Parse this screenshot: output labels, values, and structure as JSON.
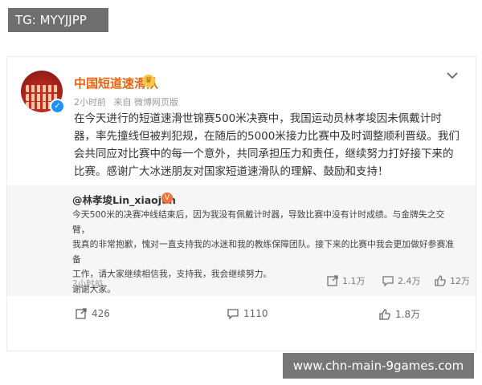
{
  "tg_label": "TG: MYYJJPP",
  "post": {
    "author": "中国短道速滑队",
    "meta": {
      "time": "2小时前",
      "source": "来自 微博网页版"
    },
    "text": "在今天进行的短道速滑世锦赛500米决赛中，我国运动员林孝埈因未佩戴计时器，率先撞线但被判犯规，在随后的5000米接力比赛中及时调整顺利晋级。我们会共同应对比赛中的每一个意外，共同承担压力和责任，继续努力打好接下来的比赛。感谢广大冰迷朋友对国家短道速滑队的理解、鼓励和支持！",
    "repost": {
      "author": "@林孝埈Lin_xiaojun",
      "text_lines": [
        "今天500米的决赛冲线结束后，因为我没有佩戴计时器，导致比赛中没有计时成绩。与金牌失之交臂，",
        "我真的非常抱歉，愧对一直支持我的冰迷和我的教练保障团队。接下来的比赛中我会更加做好参赛准备",
        "工作，请大家继续相信我，支持我，我会继续努力。",
        "谢谢大家。"
      ],
      "time": "2小时前",
      "reposts": "1.1万",
      "comments": "2.4万",
      "likes": "12万"
    },
    "stats": {
      "reposts": "426",
      "comments": "1110",
      "likes": "1.8万"
    }
  },
  "watermark": "www.chn-main-9games.com",
  "colors": {
    "author": "#e8620e",
    "verified": "#1e90ff"
  }
}
